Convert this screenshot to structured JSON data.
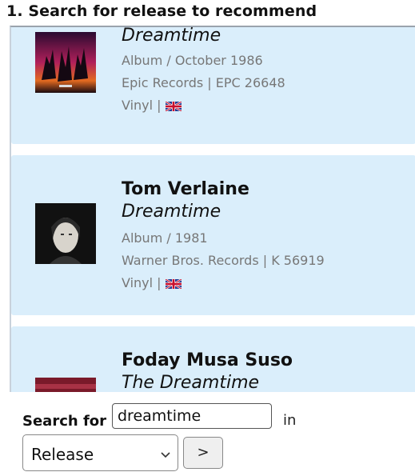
{
  "heading": "1. Search for release to recommend",
  "results": [
    {
      "artist": "",
      "title": "Dreamtime",
      "format_line": "Album / October 1986",
      "label_line": "Epic Records | EPC 26648",
      "medium": "Vinyl |",
      "country_flag": "uk-flag-icon"
    },
    {
      "artist": "Tom Verlaine",
      "title": "Dreamtime",
      "format_line": "Album / 1981",
      "label_line": "Warner Bros. Records | K 56919",
      "medium": "Vinyl |",
      "country_flag": "uk-flag-icon"
    },
    {
      "artist": "Foday Musa Suso",
      "title": "The Dreamtime"
    }
  ],
  "search": {
    "label": "Search for",
    "value": "dreamtime",
    "in_label": "in",
    "type_selected": "Release",
    "go_label": ">"
  },
  "colors": {
    "card_background": "#daeefb",
    "meta_text": "#777777"
  }
}
